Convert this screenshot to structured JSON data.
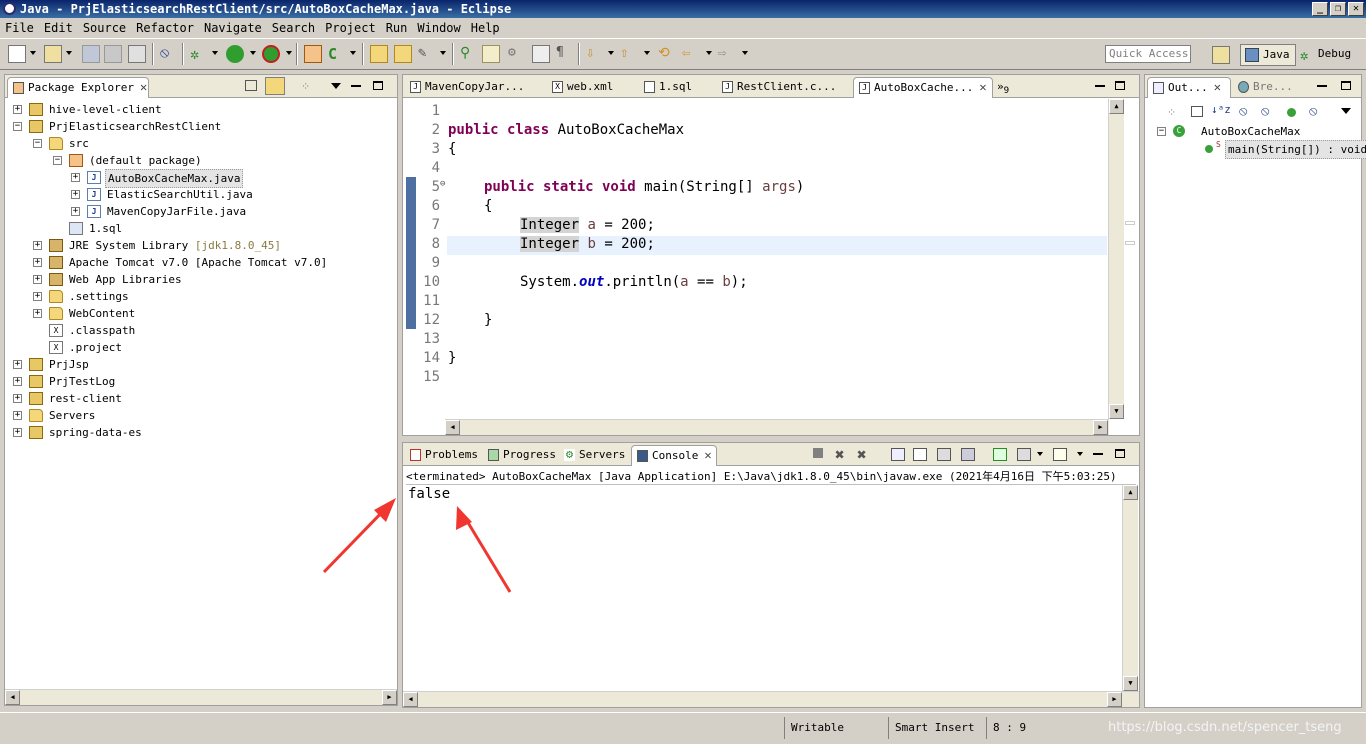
{
  "window": {
    "title": "Java - PrjElasticsearchRestClient/src/AutoBoxCacheMax.java - Eclipse",
    "minimize": "_",
    "restore": "❐",
    "close": "✕"
  },
  "menu": [
    "File",
    "Edit",
    "Source",
    "Refactor",
    "Navigate",
    "Search",
    "Project",
    "Run",
    "Window",
    "Help"
  ],
  "toolbar": {
    "quick_access_placeholder": "Quick Access",
    "perspective_java": "Java",
    "perspective_debug": "Debug"
  },
  "package_explorer": {
    "tab_label": "Package Explorer",
    "tree": [
      {
        "label": "hive-level-client",
        "type": "project"
      },
      {
        "label": "PrjElasticsearchRestClient",
        "type": "project"
      },
      {
        "label": "src",
        "type": "srcfolder"
      },
      {
        "label": "(default package)",
        "type": "package"
      },
      {
        "label": "AutoBoxCacheMax.java",
        "type": "java"
      },
      {
        "label": "ElasticSearchUtil.java",
        "type": "java"
      },
      {
        "label": "MavenCopyJarFile.java",
        "type": "java"
      },
      {
        "label": "1.sql",
        "type": "file"
      },
      {
        "label": "JRE System Library",
        "suffix": "[jdk1.8.0_45]",
        "type": "lib"
      },
      {
        "label": "Apache Tomcat v7.0 [Apache Tomcat v7.0]",
        "type": "lib"
      },
      {
        "label": "Web App Libraries",
        "type": "lib"
      },
      {
        "label": ".settings",
        "type": "folder"
      },
      {
        "label": "WebContent",
        "type": "folder"
      },
      {
        "label": ".classpath",
        "type": "xml"
      },
      {
        "label": ".project",
        "type": "xml"
      },
      {
        "label": "PrjJsp",
        "type": "project"
      },
      {
        "label": "PrjTestLog",
        "type": "project"
      },
      {
        "label": "rest-client",
        "type": "project"
      },
      {
        "label": "Servers",
        "type": "folder"
      },
      {
        "label": "spring-data-es",
        "type": "project"
      }
    ]
  },
  "editor": {
    "tabs": [
      "MavenCopyJar...",
      "web.xml",
      "1.sql",
      "RestClient.c...",
      "AutoBoxCache..."
    ],
    "overflow_count": "9",
    "line_numbers": [
      "1",
      "2",
      "3",
      "4",
      "5",
      "6",
      "7",
      "8",
      "9",
      "10",
      "11",
      "12",
      "13",
      "14",
      "15"
    ],
    "code": {
      "l2_kw": "public class",
      "l2_rest": " AutoBoxCacheMax",
      "l3": "{",
      "l5_kw": "public static void",
      "l5_rest": " main(String[] ",
      "l5_arg": "args",
      "l5_end": ")",
      "l6": "{",
      "l7_type": "Integer",
      "l7_var": "a",
      "l7_rest": " = 200;",
      "l8_type": "Integer",
      "l8_var": "b",
      "l8_rest": " = 200;",
      "l10_a": "System.",
      "l10_out": "out",
      "l10_b": ".println(",
      "l10_va": "a",
      "l10_mid": " == ",
      "l10_vb": "b",
      "l10_end": ");",
      "l12": "}",
      "l14": "}"
    }
  },
  "console": {
    "tabs": [
      "Problems",
      "Progress",
      "Servers",
      "Console"
    ],
    "status": "<terminated> AutoBoxCacheMax [Java Application] E:\\Java\\jdk1.8.0_45\\bin\\javaw.exe (2021年4月16日 下午5:03:25)",
    "output": "false"
  },
  "outline": {
    "tabs": [
      "Out...",
      "Bre..."
    ],
    "class_name": "AutoBoxCacheMax",
    "method": "main(String[]) : void",
    "static_marker": "S"
  },
  "statusbar": {
    "writable": "Writable",
    "insert_mode": "Smart Insert",
    "position": "8 : 9",
    "watermark": "https://blog.csdn.net/spencer_tseng"
  },
  "colors": {
    "arrow": "#f0362f",
    "keyword": "#7f0055"
  }
}
